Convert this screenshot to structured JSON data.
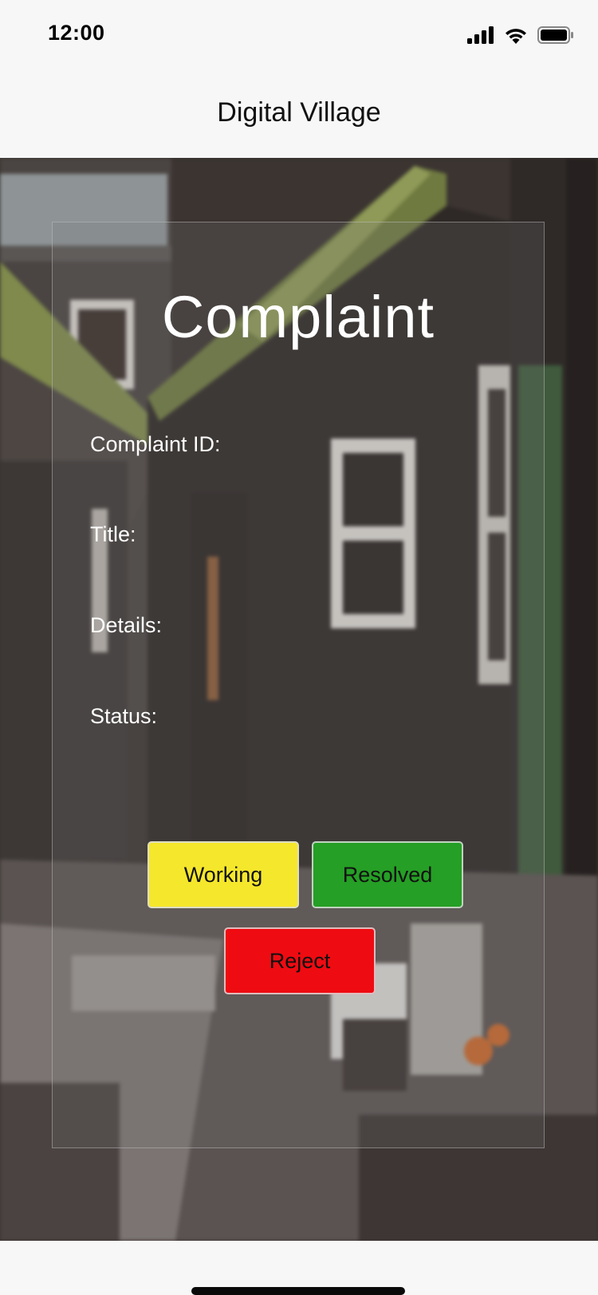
{
  "status_bar": {
    "time": "12:00",
    "icons": [
      "cellular-signal-icon",
      "wifi-icon",
      "battery-icon"
    ]
  },
  "header": {
    "title": "Digital Village"
  },
  "background": {
    "image": "village-houses-photo"
  },
  "card": {
    "title": "Complaint",
    "fields": {
      "complaint_id_label": "Complaint ID:",
      "title_label": "Title:",
      "details_label": "Details:",
      "status_label": "Status:"
    },
    "buttons": {
      "working": "Working",
      "resolved": "Resolved",
      "reject": "Reject"
    }
  },
  "colors": {
    "working": "#f5e72b",
    "resolved": "#259f25",
    "reject": "#ef0b12"
  }
}
